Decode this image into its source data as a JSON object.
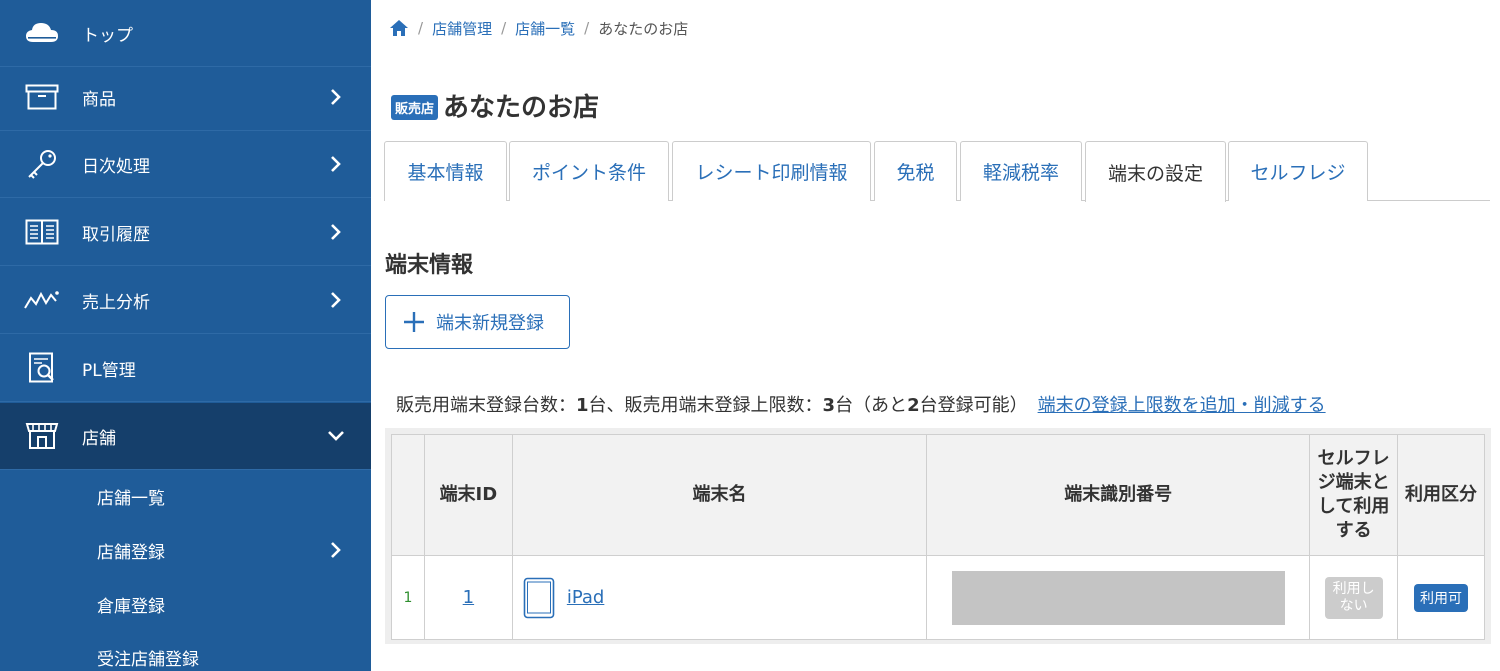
{
  "sidebar": {
    "items": [
      {
        "label": "トップ",
        "icon": "cloud-icon"
      },
      {
        "label": "商品",
        "icon": "box-icon"
      },
      {
        "label": "日次処理",
        "icon": "key-icon"
      },
      {
        "label": "取引履歴",
        "icon": "book-icon"
      },
      {
        "label": "売上分析",
        "icon": "trend-icon"
      },
      {
        "label": "PL管理",
        "icon": "report-icon"
      },
      {
        "label": "店舗",
        "icon": "store-icon"
      }
    ],
    "subitems": [
      {
        "label": "店舗一覧"
      },
      {
        "label": "店舗登録"
      },
      {
        "label": "倉庫登録"
      },
      {
        "label": "受注店舗登録"
      }
    ]
  },
  "breadcrumb": {
    "items": [
      "店舗管理",
      "店舗一覧"
    ],
    "current": "あなたのお店",
    "sep": "/"
  },
  "header": {
    "badge": "販売店",
    "title": "あなたのお店"
  },
  "tabs": [
    {
      "label": "基本情報"
    },
    {
      "label": "ポイント条件"
    },
    {
      "label": "レシート印刷情報"
    },
    {
      "label": "免税"
    },
    {
      "label": "軽減税率"
    },
    {
      "label": "端末の設定"
    },
    {
      "label": "セルフレジ"
    }
  ],
  "section": {
    "title": "端末情報",
    "add_button": "端末新規登録"
  },
  "count": {
    "p1": "販売用端末登録台数：",
    "v1": "1",
    "p2": "台、販売用端末登録上限数：",
    "v2": "3",
    "p3": "台（あと",
    "v3": "2",
    "p4": "台登録可能）",
    "link": "端末の登録上限数を追加・削減する"
  },
  "table": {
    "headers": {
      "id": "端末ID",
      "name": "端末名",
      "serial": "端末識別番号",
      "self": "セルフレ ジ端末と して利用 する",
      "usage": "利用区分"
    },
    "rows": [
      {
        "num": "1",
        "id": "1",
        "name": "iPad",
        "self": "利用し ない",
        "usage": "利用可"
      }
    ]
  },
  "colors": {
    "sidebar": "#1f5c99",
    "sidebar_active": "#153f6b",
    "accent": "#2a6fb8"
  }
}
